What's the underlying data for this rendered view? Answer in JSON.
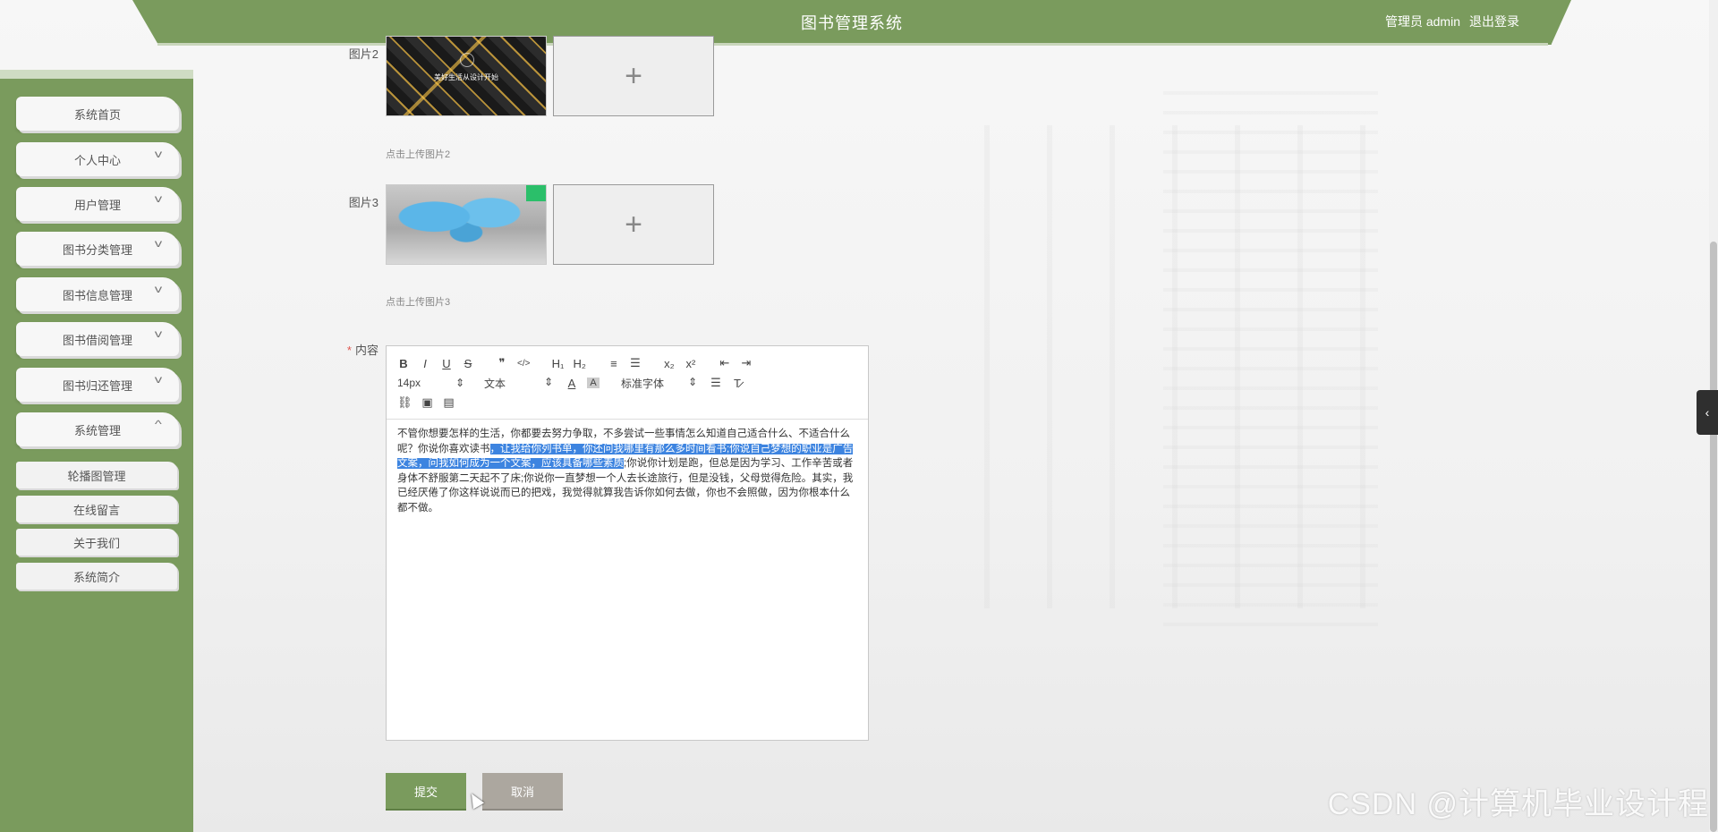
{
  "header": {
    "title": "图书管理系统",
    "user_label": "管理员 admin",
    "logout_label": "退出登录"
  },
  "sidebar": {
    "items": [
      {
        "label": "系统首页",
        "chevron": ""
      },
      {
        "label": "个人中心",
        "chevron": "v"
      },
      {
        "label": "用户管理",
        "chevron": "v"
      },
      {
        "label": "图书分类管理",
        "chevron": "v"
      },
      {
        "label": "图书信息管理",
        "chevron": "v"
      },
      {
        "label": "图书借阅管理",
        "chevron": "v"
      },
      {
        "label": "图书归还管理",
        "chevron": "v"
      },
      {
        "label": "系统管理",
        "chevron": "^"
      }
    ],
    "subitems": [
      {
        "label": "轮播图管理"
      },
      {
        "label": "在线留言"
      },
      {
        "label": "关于我们"
      },
      {
        "label": "系统简介"
      }
    ]
  },
  "form": {
    "image2": {
      "label": "图片2",
      "thumb_caption": "美好生活从设计开始",
      "hint": "点击上传图片2",
      "upload_symbol": "+"
    },
    "image3": {
      "label": "图片3",
      "hint": "点击上传图片3",
      "upload_symbol": "+"
    },
    "content": {
      "required_mark": "*",
      "label": "内容"
    }
  },
  "editor": {
    "toolbar_row1": [
      "B",
      "I",
      "U",
      "S",
      "❞",
      "</>",
      "H₁",
      "H₂",
      "≡",
      "☰",
      "x₂",
      "x²",
      "⇤",
      "⇥"
    ],
    "font_size": "14px",
    "block_type": "文本",
    "font_family": "标准字体",
    "body_parts": [
      "不管你想要怎样的生活，你都要去努力争取，不多尝试一些事情怎么知道自己适合什么、不适合什么呢？你说你喜欢读书",
      "，让我给你列书单，你还问我哪里有那么多时间看书;你说自己梦想的职业是广告文案，问我如何成为一个文案，应该具备哪些素质",
      ";你说你计划是跑，但总是因为学习、工作辛苦或者身体不舒服第二天起不了床;你说你一直梦想一个人去长途旅行，但是没钱，父母觉得危险。其实，我已经厌倦了你这样说说而已的把戏，我觉得就算我告诉你如何去做，你也不会照做，因为你根本什么都不做。"
    ]
  },
  "actions": {
    "submit_label": "提交",
    "cancel_label": "取消"
  },
  "side_tab": {
    "icon": "‹"
  },
  "watermark": "CSDN @计算机毕业设计程"
}
